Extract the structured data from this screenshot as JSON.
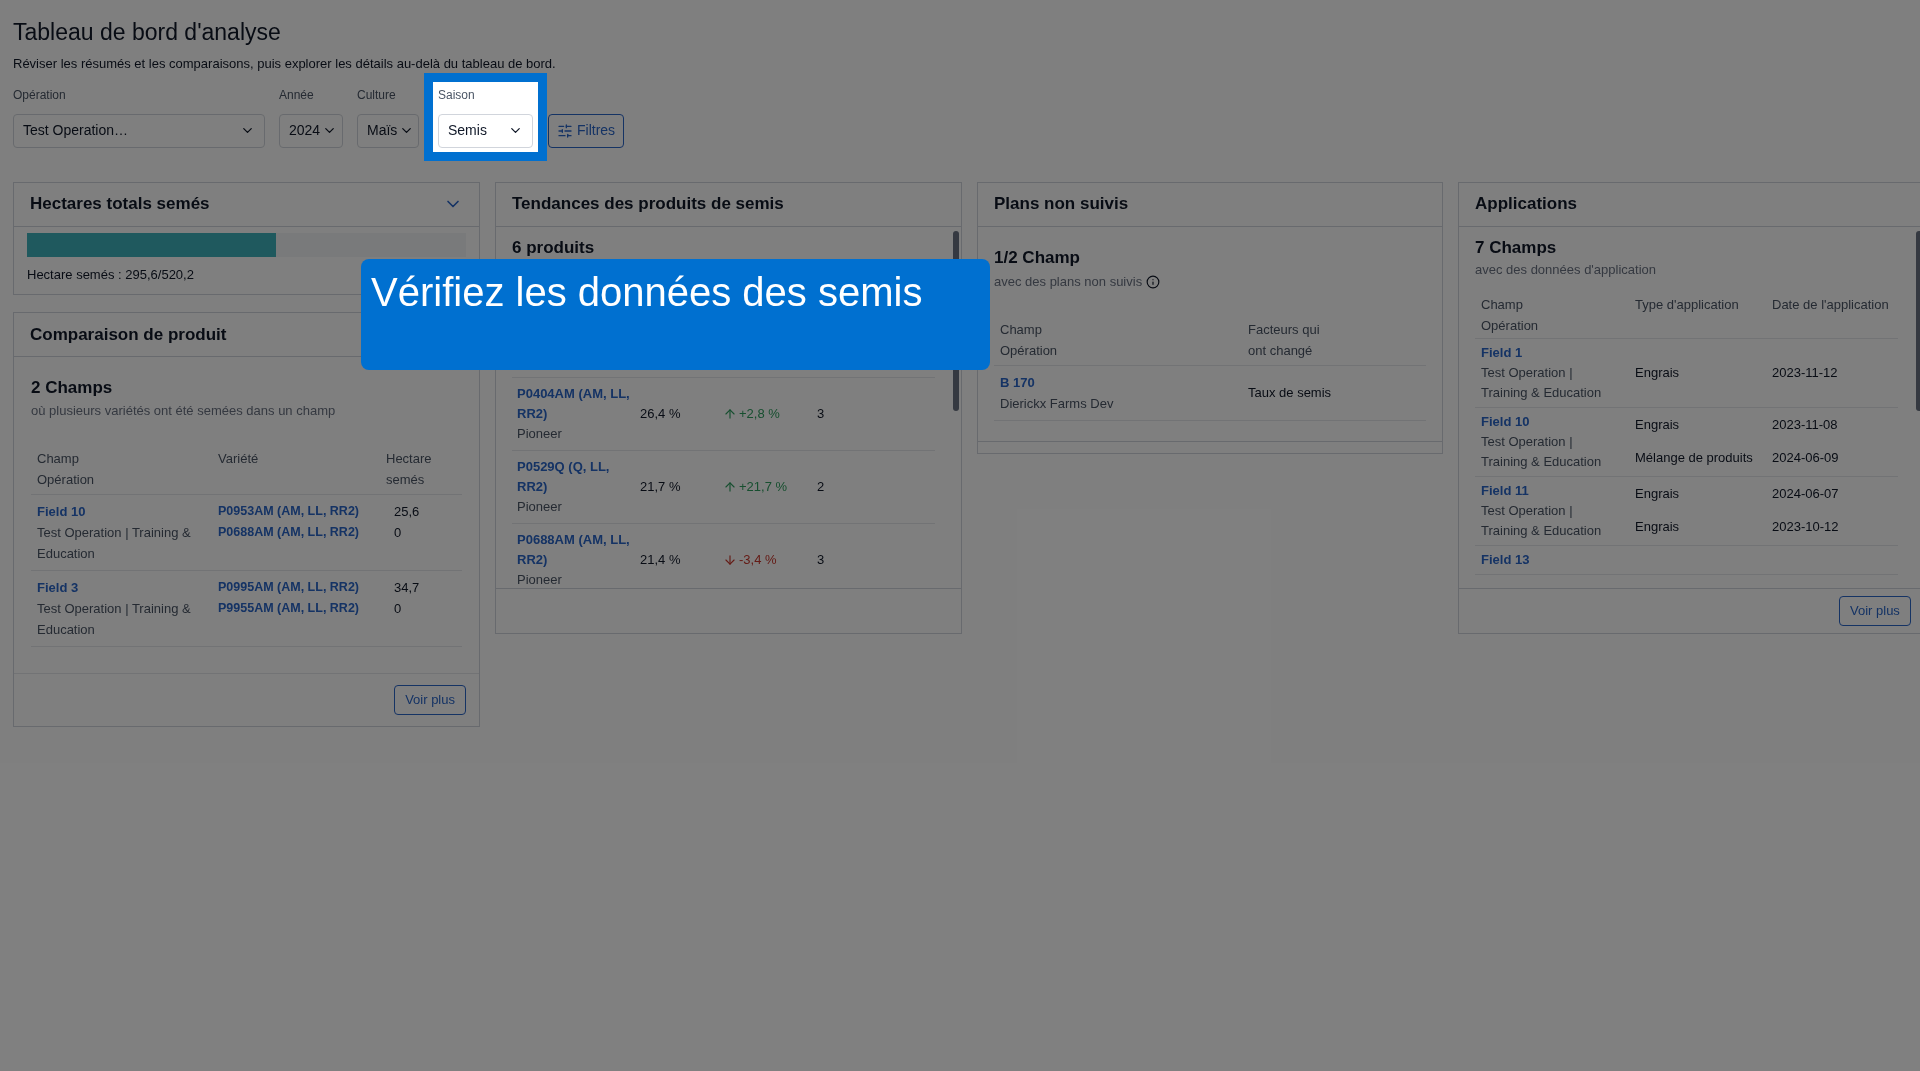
{
  "header": {
    "title": "Tableau de bord d'analyse",
    "subtitle": "Réviser les résumés et les comparaisons, puis explorer les détails au-delà du tableau de bord."
  },
  "filters": [
    {
      "label": "Opération",
      "value": "Test Operation…",
      "highlighted": false
    },
    {
      "label": "Année",
      "value": "2024",
      "highlighted": false
    },
    {
      "label": "Culture",
      "value": "Maïs",
      "highlighted": false
    },
    {
      "label": "Saison",
      "value": "Semis",
      "highlighted": true
    }
  ],
  "filters_button": "Filtres",
  "tour_tooltip": {
    "text": "Vérifiez les données des semis"
  },
  "hectares": {
    "title": "Hectares totals semés",
    "level": 0.568,
    "reading": "Hectare semés : 295,6/520,2"
  },
  "comparison": {
    "title": "Comparaison de produit",
    "count": "2 Champs",
    "subtitle": "où plusieurs variétés ont été semées dans un champ",
    "columns": [
      "Champ\nOpération",
      "Variété",
      "Hectare\nsemés"
    ],
    "rows": [
      {
        "field": "Field 10",
        "operation": "Test Operation | Training & Education",
        "varieties": [
          "P0953AM (AM, LL, RR2)",
          "P0688AM (AM, LL, RR2)"
        ],
        "hectares": [
          "25,6",
          "0"
        ]
      },
      {
        "field": "Field 3",
        "operation": "Test Operation | Training & Education",
        "varieties": [
          "P0995AM (AM, LL, RR2)",
          "P9955AM (AM, LL, RR2)"
        ],
        "hectares": [
          "34,7",
          "0"
        ]
      }
    ],
    "button": "Voir plus"
  },
  "trends": {
    "title": "Tendances des produits de semis",
    "count": "6 produits",
    "rows": [
      {
        "product": "P0404AM (AM, LL, RR2)",
        "brand": "Pioneer",
        "share": "26,4 %",
        "kind": "up",
        "change": "+2,8 %",
        "count": "3"
      },
      {
        "product": "P0529Q (Q, LL, RR2)",
        "brand": "Pioneer",
        "share": "21,7 %",
        "kind": "up",
        "change": "+21,7 %",
        "count": "2"
      },
      {
        "product": "P0688AM (AM, LL, RR2)",
        "brand": "Pioneer",
        "share": "21,4 %",
        "kind": "down",
        "change": "-3,4 %",
        "count": "3"
      }
    ]
  },
  "plans": {
    "title": "Plans non suivis",
    "count": "1/2 Champ",
    "subtitle": "avec des plans non suivis",
    "columns": [
      "Champ\nOpération",
      "Facteurs qui\nont changé"
    ],
    "rows": [
      {
        "field": "B 170",
        "operation": "Dierickx Farms Dev",
        "factor": "Taux de semis"
      }
    ]
  },
  "applications": {
    "title": "Applications",
    "count": "7 Champs",
    "subtitle": "avec des données d'application",
    "columns": [
      "Champ\nOpération",
      "Type d'application",
      "Date de l'application"
    ],
    "rows": [
      {
        "field": "Field 1",
        "operation": "Test Operation |\nTraining & Education",
        "entries": [
          {
            "type": "Engrais",
            "date": "2023-11-12"
          }
        ]
      },
      {
        "field": "Field 10",
        "operation": "Test Operation |\nTraining & Education",
        "entries": [
          {
            "type": "Engrais",
            "date": "2023-11-08"
          },
          {
            "type": "Mélange de produits",
            "date": "2024-06-09"
          }
        ]
      },
      {
        "field": "Field 11",
        "operation": "Test Operation |\nTraining & Education",
        "entries": [
          {
            "type": "Engrais",
            "date": "2024-06-07"
          },
          {
            "type": "Engrais",
            "date": "2023-10-12"
          }
        ]
      },
      {
        "field": "Field 13"
      }
    ],
    "button": "Voir plus"
  }
}
